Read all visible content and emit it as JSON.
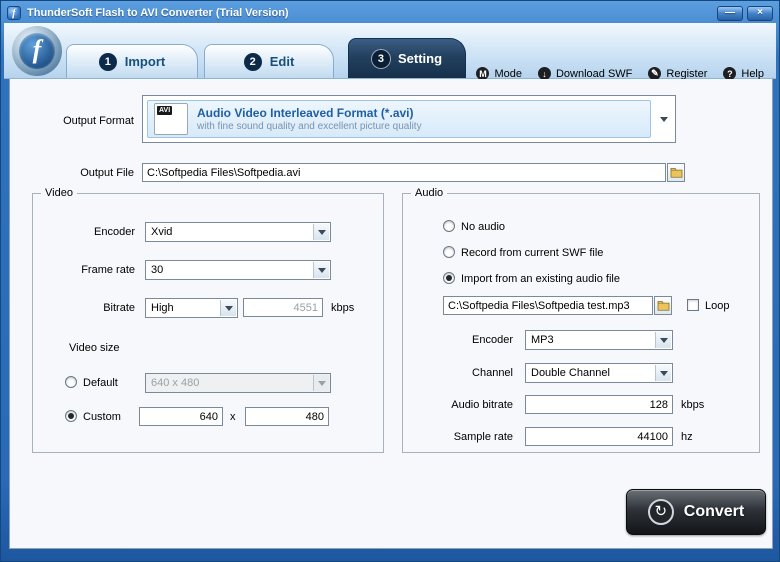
{
  "window": {
    "title": "ThunderSoft Flash to AVI Converter (Trial Version)",
    "app_icon_glyph": "f",
    "minimize_glyph": "—",
    "close_glyph": "×"
  },
  "header": {
    "logo_glyph": "f",
    "tabs": [
      {
        "num": "1",
        "label": "Import"
      },
      {
        "num": "2",
        "label": "Edit"
      },
      {
        "num": "3",
        "label": "Setting"
      }
    ],
    "menu": [
      {
        "icon": "M",
        "label": "Mode"
      },
      {
        "icon": "↓",
        "label": "Download SWF"
      },
      {
        "icon": "✎",
        "label": "Register"
      },
      {
        "icon": "?",
        "label": "Help"
      }
    ]
  },
  "output_format": {
    "label": "Output Format",
    "icon_text": "AVI",
    "title": "Audio Video Interleaved Format (*.avi)",
    "subtitle": "with fine sound quality and excellent picture quality"
  },
  "output_file": {
    "label": "Output File",
    "value": "C:\\Softpedia Files\\Softpedia.avi"
  },
  "video": {
    "legend": "Video",
    "encoder_label": "Encoder",
    "encoder_value": "Xvid",
    "framerate_label": "Frame rate",
    "framerate_value": "30",
    "bitrate_label": "Bitrate",
    "bitrate_value": "High",
    "bitrate_custom": "4551",
    "bitrate_unit": "kbps",
    "size_label": "Video size",
    "default_label": "Default",
    "default_size": "640 x 480",
    "default_selected": false,
    "custom_label": "Custom",
    "custom_selected": true,
    "custom_width": "640",
    "separator": "x",
    "custom_height": "480"
  },
  "audio": {
    "legend": "Audio",
    "no_audio_label": "No audio",
    "no_audio_selected": false,
    "record_label": "Record from current SWF file",
    "record_selected": false,
    "import_label": "Import from an existing audio file",
    "import_selected": true,
    "file_value": "C:\\Softpedia Files\\Softpedia test.mp3",
    "loop_label": "Loop",
    "loop_checked": false,
    "encoder_label": "Encoder",
    "encoder_value": "MP3",
    "channel_label": "Channel",
    "channel_value": "Double Channel",
    "bitrate_label": "Audio bitrate",
    "bitrate_value": "128",
    "bitrate_unit": "kbps",
    "samplerate_label": "Sample rate",
    "samplerate_value": "44100",
    "samplerate_unit": "hz"
  },
  "convert": {
    "label": "Convert",
    "icon_glyph": "↻"
  },
  "colors": {
    "accent_blue": "#1d5fa8",
    "active_tab": "#16304b",
    "titlebar": "#2e72bd"
  }
}
